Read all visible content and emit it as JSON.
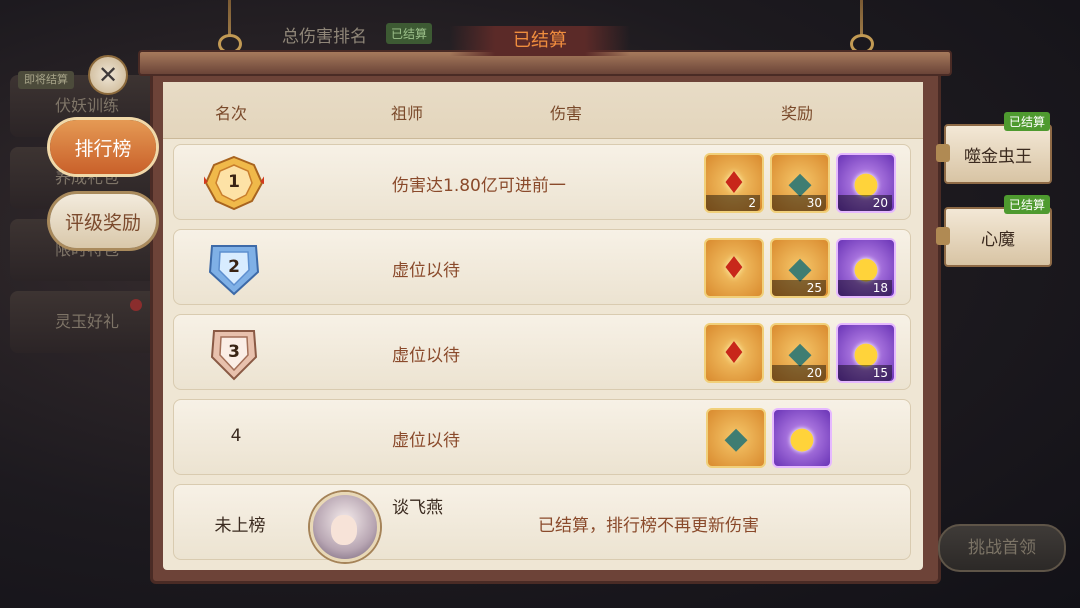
{
  "background": {
    "top_title": "总伤害排名",
    "top_tag": "已结算",
    "left_items": [
      {
        "label": "伏妖训练",
        "tag": "即将结算"
      },
      {
        "label": "养成礼包"
      },
      {
        "label": "限时特包"
      },
      {
        "label": "灵玉好礼"
      }
    ]
  },
  "banner": "已结算",
  "side_tabs": {
    "ranking": "排行榜",
    "grade_rewards": "评级奖励"
  },
  "header": {
    "rank": "名次",
    "master": "祖师",
    "damage": "伤害",
    "reward": "奖励"
  },
  "rows": [
    {
      "rank": "1",
      "label": "伤害达1.80亿可进前一",
      "rewards": [
        "2",
        "30",
        "20"
      ]
    },
    {
      "rank": "2",
      "label": "虚位以待",
      "rewards": [
        "",
        "25",
        "18"
      ]
    },
    {
      "rank": "3",
      "label": "虚位以待",
      "rewards": [
        "",
        "20",
        "15"
      ]
    },
    {
      "rank": "4",
      "label": "虚位以待",
      "rewards": [
        "",
        ""
      ]
    }
  ],
  "player": {
    "rank": "未上榜",
    "name": "谈飞燕",
    "notice": "已结算，排行榜不再更新伤害"
  },
  "bosses": [
    {
      "name": "噬金虫王",
      "tag": "已结算"
    },
    {
      "name": "心魔",
      "tag": "已结算"
    }
  ],
  "challenge_button": "挑战首领",
  "icons": {
    "close": "close-icon",
    "flame": "flame-token-icon",
    "gem": "crystal-shard-icon",
    "drop": "gold-essence-icon"
  },
  "colors": {
    "accent": "#f08d3e",
    "active_tab": "#e59a54",
    "settled_tag": "#4e9a2f",
    "panel_bg": "#efe6d4"
  }
}
